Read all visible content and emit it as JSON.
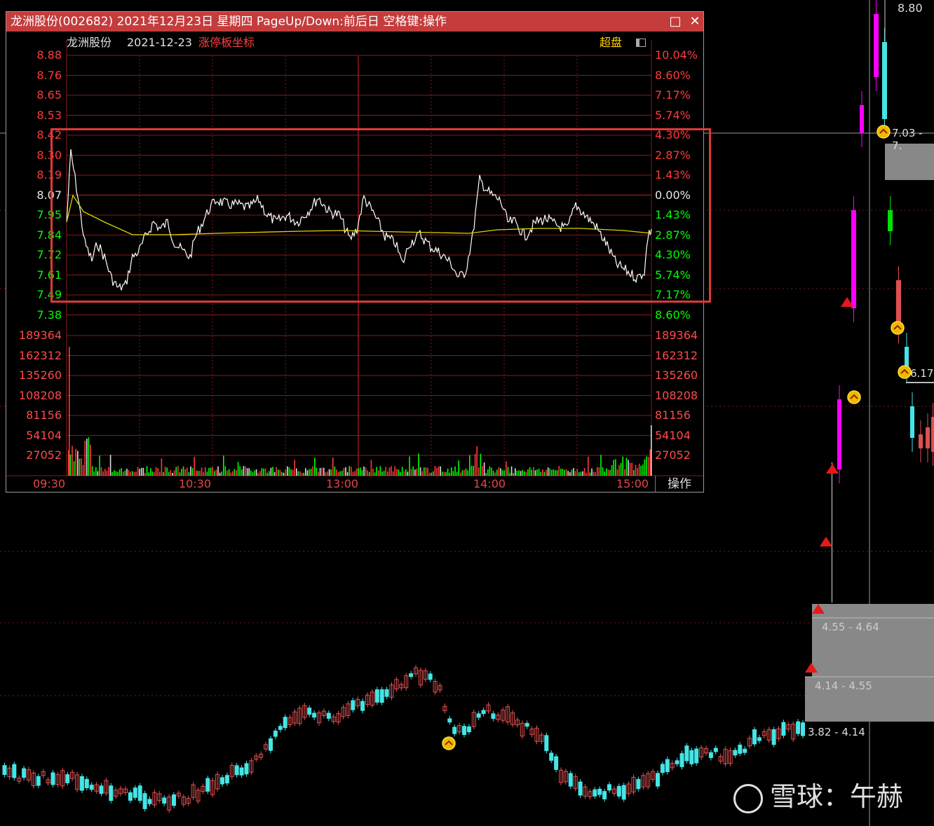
{
  "window": {
    "title": "龙洲股份(002682) 2021年12月23日 星期四 PageUp/Down:前后日 空格键:操作",
    "maximize_icon": "□",
    "close_icon": "✕"
  },
  "header": {
    "stock_name": "龙洲股份",
    "date": "2021-12-23",
    "mode": "涨停板坐标",
    "overlay_label": "超盘",
    "toggle_icon": "toggle-icon"
  },
  "price_axis": {
    "left": [
      "8.88",
      "8.76",
      "8.65",
      "8.53",
      "8.42",
      "8.30",
      "8.19",
      "8.07",
      "7.95",
      "7.84",
      "7.72",
      "7.61",
      "7.49",
      "7.38"
    ],
    "right": [
      "10.04%",
      "8.60%",
      "7.17%",
      "5.74%",
      "4.30%",
      "2.87%",
      "1.43%",
      "0.00%",
      "1.43%",
      "2.87%",
      "4.30%",
      "5.74%",
      "7.17%",
      "8.60%"
    ]
  },
  "volume_axis": {
    "left": [
      "189364",
      "162312",
      "135260",
      "108208",
      "81156",
      "54104",
      "27052"
    ],
    "right": [
      "189364",
      "162312",
      "135260",
      "108208",
      "81156",
      "54104",
      "27052"
    ]
  },
  "time_axis": [
    "09:30",
    "10:30",
    "13:00",
    "14:00",
    "15:00"
  ],
  "operate_label": "操作",
  "colors": {
    "up": "#ff3a3a",
    "down": "#00ff00",
    "neutral": "#e8e8e8",
    "title_bg": "#c43c3c",
    "price_line": "#ffffff",
    "avg_line": "#d8d800",
    "highlight": "#e03838",
    "kline_up": "#e05050",
    "kline_down": "#45e5e5",
    "kline_limit": "#ff00ff"
  },
  "kline_chart": {
    "top_price_label": "8.80",
    "mid_price_label": "7.03 - 7.",
    "side_price_label": "6.17",
    "zones": [
      "4.55 - 4.64",
      "4.14 - 4.55",
      "3.82 - 4.14"
    ]
  },
  "watermark": {
    "brand": "雪球",
    "author": "午赫",
    "separator": "："
  }
}
